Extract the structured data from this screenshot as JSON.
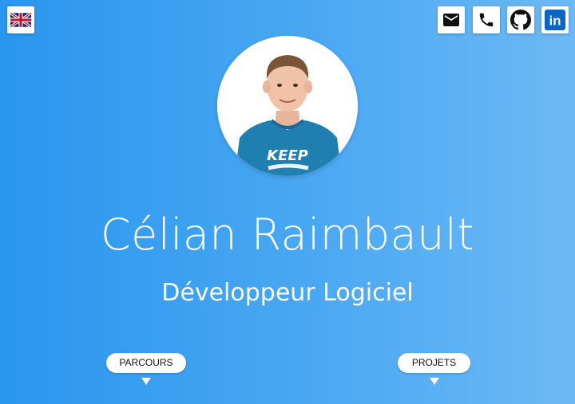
{
  "header": {
    "language_flag": "uk-flag-icon",
    "contact_icons": [
      "mail-icon",
      "phone-icon",
      "github-icon",
      "linkedin-icon"
    ],
    "linkedin_text": "in"
  },
  "profile": {
    "name": "Célian Raimbault",
    "title": "Développeur Logiciel",
    "shirt_text": "KEEP"
  },
  "nav": {
    "parcours_label": "PARCOURS",
    "projets_label": "PROJETS"
  },
  "colors": {
    "gradient_start": "#2a96ee",
    "gradient_end": "#6db9f5",
    "linkedin_blue": "#0a66c2",
    "shirt_teal": "#1f7fb0"
  }
}
